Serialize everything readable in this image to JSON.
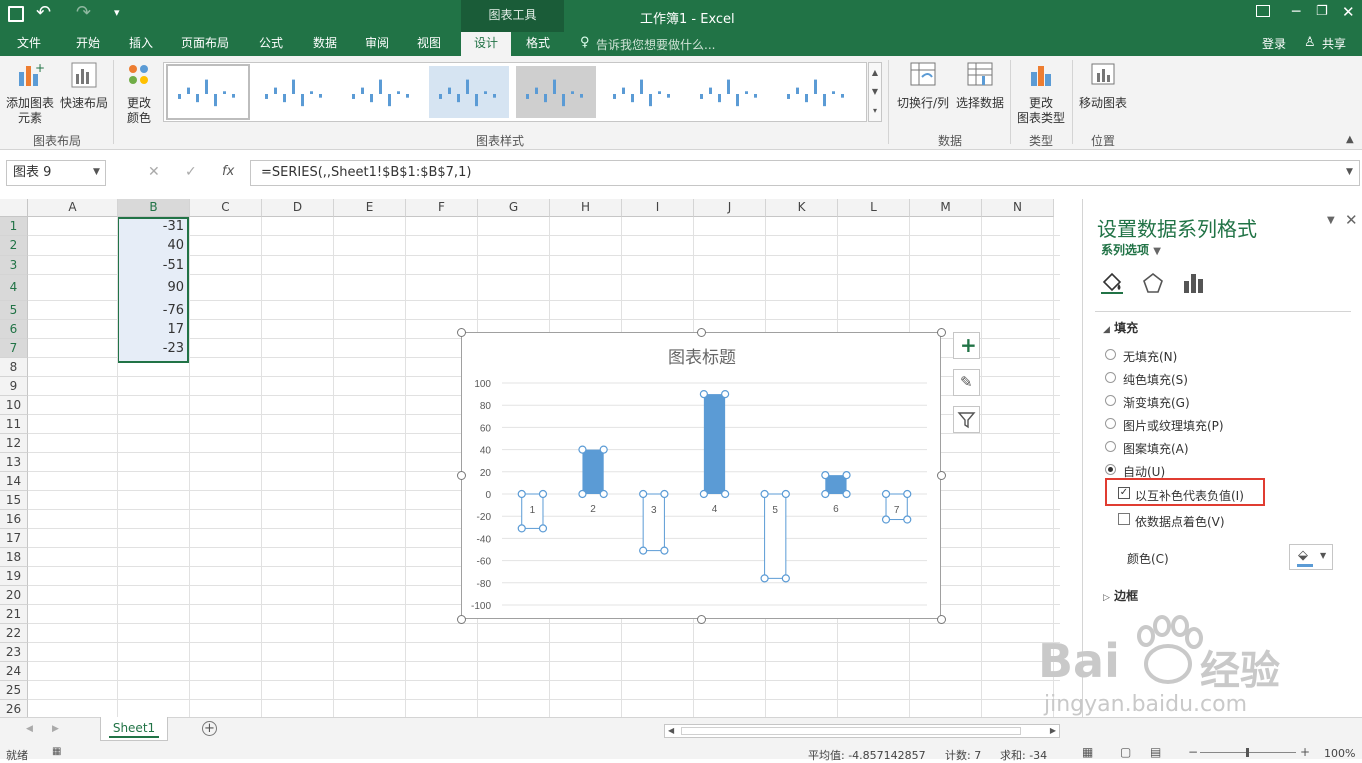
{
  "titlebar": {
    "window_title": "工作簿1 - Excel",
    "chart_tools": "图表工具"
  },
  "ribbon_tabs": [
    "文件",
    "开始",
    "插入",
    "页面布局",
    "公式",
    "数据",
    "审阅",
    "视图",
    "设计",
    "格式"
  ],
  "tell_me": "告诉我您想要做什么...",
  "account": {
    "login": "登录",
    "share": "共享"
  },
  "ribbon": {
    "add_element_1": "添加图表",
    "add_element_2": "元素",
    "quick_layout": "快速布局",
    "change_color_1": "更改",
    "change_color_2": "颜色",
    "group_layout": "图表布局",
    "group_styles": "图表样式",
    "switch_row_col": "切换行/列",
    "select_data": "选择数据",
    "group_data": "数据",
    "change_type_1": "更改",
    "change_type_2": "图表类型",
    "group_type": "类型",
    "move_chart": "移动图表",
    "group_location": "位置"
  },
  "formula_bar": {
    "name_box": "图表 9",
    "fx": "fx",
    "formula": "=SERIES(,,Sheet1!$B$1:$B$7,1)"
  },
  "columns": [
    "A",
    "B",
    "C",
    "D",
    "E",
    "F",
    "G",
    "H",
    "I",
    "J",
    "K",
    "L",
    "M",
    "N"
  ],
  "rows": [
    "1",
    "2",
    "3",
    "4",
    "5",
    "6",
    "7",
    "8",
    "9",
    "10",
    "11",
    "12",
    "13",
    "14",
    "15",
    "16",
    "17",
    "18",
    "19",
    "20",
    "21",
    "22",
    "23",
    "24",
    "25",
    "26"
  ],
  "b_values": [
    "-31",
    "40",
    "-51",
    "90",
    "-76",
    "17",
    "-23"
  ],
  "chart_data": {
    "type": "bar",
    "title": "图表标题",
    "categories": [
      "1",
      "2",
      "3",
      "4",
      "5",
      "6",
      "7"
    ],
    "values": [
      -31,
      40,
      -51,
      90,
      -76,
      17,
      -23
    ],
    "yticks": [
      "100",
      "80",
      "60",
      "40",
      "20",
      "0",
      "-20",
      "-40",
      "-60",
      "-80",
      "-100"
    ],
    "ylim": [
      -100,
      100
    ],
    "grid": true,
    "positive_color": "#5b9bd5",
    "negative_fill": "#ffffff"
  },
  "panel": {
    "title": "设置数据系列格式",
    "subtitle": "系列选项",
    "section_fill": "填充",
    "options": [
      "无填充(N)",
      "纯色填充(S)",
      "渐变填充(G)",
      "图片或纹理填充(P)",
      "图案填充(A)",
      "自动(U)"
    ],
    "invert_if_negative": "以互补色代表负值(I)",
    "vary_colors": "依数据点着色(V)",
    "color_label": "颜色(C)",
    "section_border": "边框",
    "highlight_color": "#e03c31"
  },
  "sheet": {
    "tab": "Sheet1"
  },
  "status": {
    "ready": "就绪",
    "average": "平均值: -4.857142857",
    "count": "计数: 7",
    "sum": "求和: -34",
    "zoom": "100%"
  },
  "watermark": {
    "brand": "Bai",
    "brand2": "经验",
    "url": "jingyan.baidu.com"
  }
}
